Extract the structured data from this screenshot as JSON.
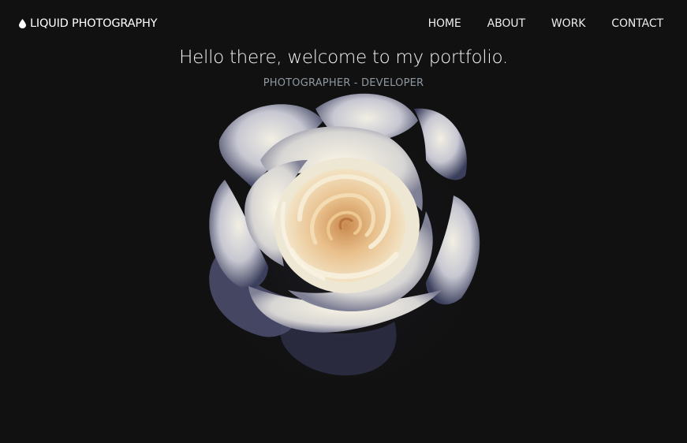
{
  "brand": {
    "icon": "water-drop-icon",
    "name": "LIQUID PHOTOGRAPHY"
  },
  "nav": {
    "items": [
      "HOME",
      "ABOUT",
      "WORK",
      "CONTACT"
    ]
  },
  "hero": {
    "title": "Hello there, welcome to my portfolio.",
    "subtitle": "PHOTOGRAPHER - DEVELOPER"
  },
  "colors": {
    "background": "#111112",
    "subtitle": "#8e98a0",
    "rose_center": "#e9b678"
  }
}
